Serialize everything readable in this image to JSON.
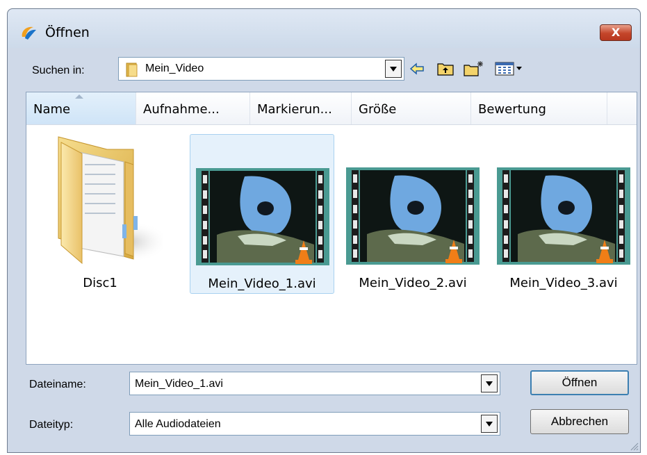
{
  "window": {
    "title": "Öffnen",
    "close_symbol": "X"
  },
  "lookin": {
    "label": "Suchen in:",
    "value": "Mein_Video"
  },
  "toolbar": [
    "back-icon",
    "up-folder-icon",
    "new-folder-icon",
    "view-menu-icon"
  ],
  "columns": [
    "Name",
    "Aufnahme...",
    "Markierun...",
    "Größe",
    "Bewertung"
  ],
  "items": [
    {
      "name": "Disc1",
      "type": "folder"
    },
    {
      "name": "Mein_Video_1.avi",
      "type": "video",
      "selected": true
    },
    {
      "name": "Mein_Video_2.avi",
      "type": "video"
    },
    {
      "name": "Mein_Video_3.avi",
      "type": "video"
    }
  ],
  "filename": {
    "label": "Dateiname:",
    "value": "Mein_Video_1.avi"
  },
  "filetype": {
    "label": "Dateityp:",
    "value": "Alle Audiodateien"
  },
  "buttons": {
    "open": "Öffnen",
    "cancel": "Abbrechen"
  }
}
